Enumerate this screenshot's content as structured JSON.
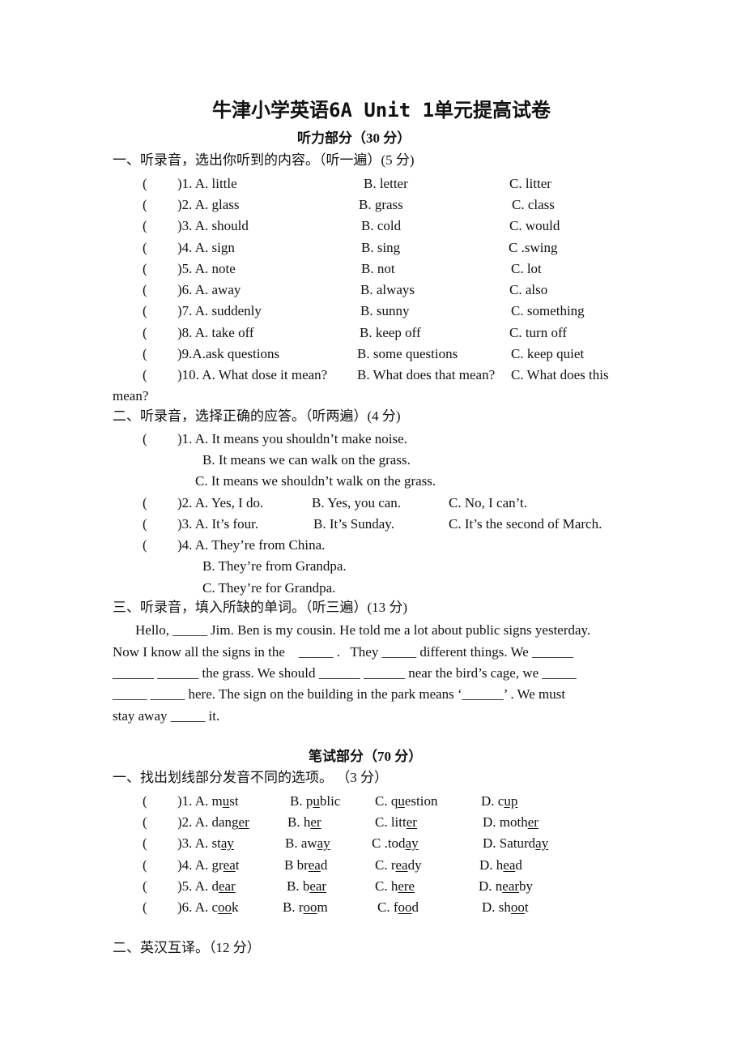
{
  "title": "牛津小学英语6A Unit 1单元提高试卷",
  "listening": {
    "heading": "听力部分（30 分）",
    "part1": {
      "heading": "一、听录音，选出你听到的内容。（听一遍）(5 分)",
      "items": [
        {
          "num": ")1. A. little",
          "b": "B. letter",
          "c": "C. litter"
        },
        {
          "num": ")2. A. glass",
          "b": "B. grass",
          "c": "C. class"
        },
        {
          "num": ")3. A. should",
          "b": "B. cold",
          "c": "C. would"
        },
        {
          "num": ")4. A. sign",
          "b": "B. sing",
          "c": "C .swing"
        },
        {
          "num": ")5. A. note",
          "b": "B. not",
          "c": "C. lot"
        },
        {
          "num": ")6. A. away",
          "b": "B. always",
          "c": "C. also"
        },
        {
          "num": ")7. A. suddenly",
          "b": "B. sunny",
          "c": "C. something"
        },
        {
          "num": ")8. A. take off",
          "b": "B. keep off",
          "c": "C. turn off"
        },
        {
          "num": ")9.A.ask questions",
          "b": "B. some questions",
          "c": "C. keep quiet"
        },
        {
          "num": ")10. A. What dose it mean?",
          "b": "B. What does that mean?",
          "c": "C. What does this"
        }
      ],
      "wrap": "mean?"
    },
    "part2": {
      "heading": "二、听录音，选择正确的应答。（听两遍）(4 分)",
      "q1": {
        "a": ")1. A. It means you shouldn’t make noise.",
        "b": "B. It means we can walk on the grass.",
        "c": "C. It means we shouldn’t walk on the grass."
      },
      "q2": {
        "a": ")2. A. Yes, I do.",
        "b": "B. Yes, you can.",
        "c": "C. No, I can’t."
      },
      "q3": {
        "a": ")3. A. It’s four.",
        "b": "B. It’s Sunday.",
        "c": "C. It’s the second of March."
      },
      "q4": {
        "a": ")4. A. They’re from China.",
        "b": "B. They’re from Grandpa.",
        "c": "C. They’re for Grandpa."
      }
    },
    "part3": {
      "heading": "三、听录音，填入所缺的单词。（听三遍）(13 分)",
      "lines": [
        "Hello, _____ Jim. Ben is my cousin. He told me a lot about public signs yesterday.",
        "Now I know all the signs in the    _____ .   They _____ different things. We ______",
        "______ ______ the grass. We should ______ ______ near the bird’s cage, we _____",
        "_____ _____ here. The sign on the building in the park means ‘______’ . We must",
        "stay away _____ it."
      ]
    }
  },
  "written": {
    "heading": "笔试部分（70 分）",
    "part1": {
      "heading": "一、找出划线部分发音不同的选项。 （3 分）",
      "items": [
        {
          "num": ")1. A. ",
          "a": [
            "m",
            "u",
            "st"
          ],
          "b": [
            "B. p",
            "u",
            "blic"
          ],
          "c": [
            "C. q",
            "u",
            "estion"
          ],
          "d": [
            "D. c",
            "up",
            ""
          ]
        },
        {
          "num": ")2. A. ",
          "a": [
            "dang",
            "er",
            ""
          ],
          "b": [
            "B. h",
            "er",
            ""
          ],
          "c": [
            "C. litt",
            "er",
            ""
          ],
          "d": [
            "D. moth",
            "er",
            ""
          ]
        },
        {
          "num": ")3. A. ",
          "a": [
            "st",
            "ay",
            ""
          ],
          "b": [
            "B. aw",
            "ay",
            ""
          ],
          "c": [
            "C .tod",
            "ay",
            ""
          ],
          "d": [
            "D. Saturd",
            "ay",
            ""
          ]
        },
        {
          "num": ")4. A. ",
          "a": [
            "gr",
            "ea",
            "t"
          ],
          "b": [
            "B br",
            "ea",
            "d"
          ],
          "c": [
            "C. r",
            "ea",
            "dy"
          ],
          "d": [
            "D. h",
            "ea",
            "d"
          ]
        },
        {
          "num": ")5. A. ",
          "a": [
            "d",
            "ear",
            ""
          ],
          "b": [
            "B. b",
            "ear",
            ""
          ],
          "c": [
            "C. h",
            "ere",
            ""
          ],
          "d": [
            "D. n",
            "ear",
            "by"
          ]
        },
        {
          "num": ")6. A. ",
          "a": [
            "c",
            "oo",
            "k"
          ],
          "b": [
            "B. r",
            "oo",
            "m"
          ],
          "c": [
            "C. f",
            "oo",
            "d"
          ],
          "d": [
            "D. sh",
            "oo",
            "t"
          ]
        }
      ]
    },
    "part2": {
      "heading": "二、英汉互译。（12 分）"
    }
  },
  "paren_open": "("
}
